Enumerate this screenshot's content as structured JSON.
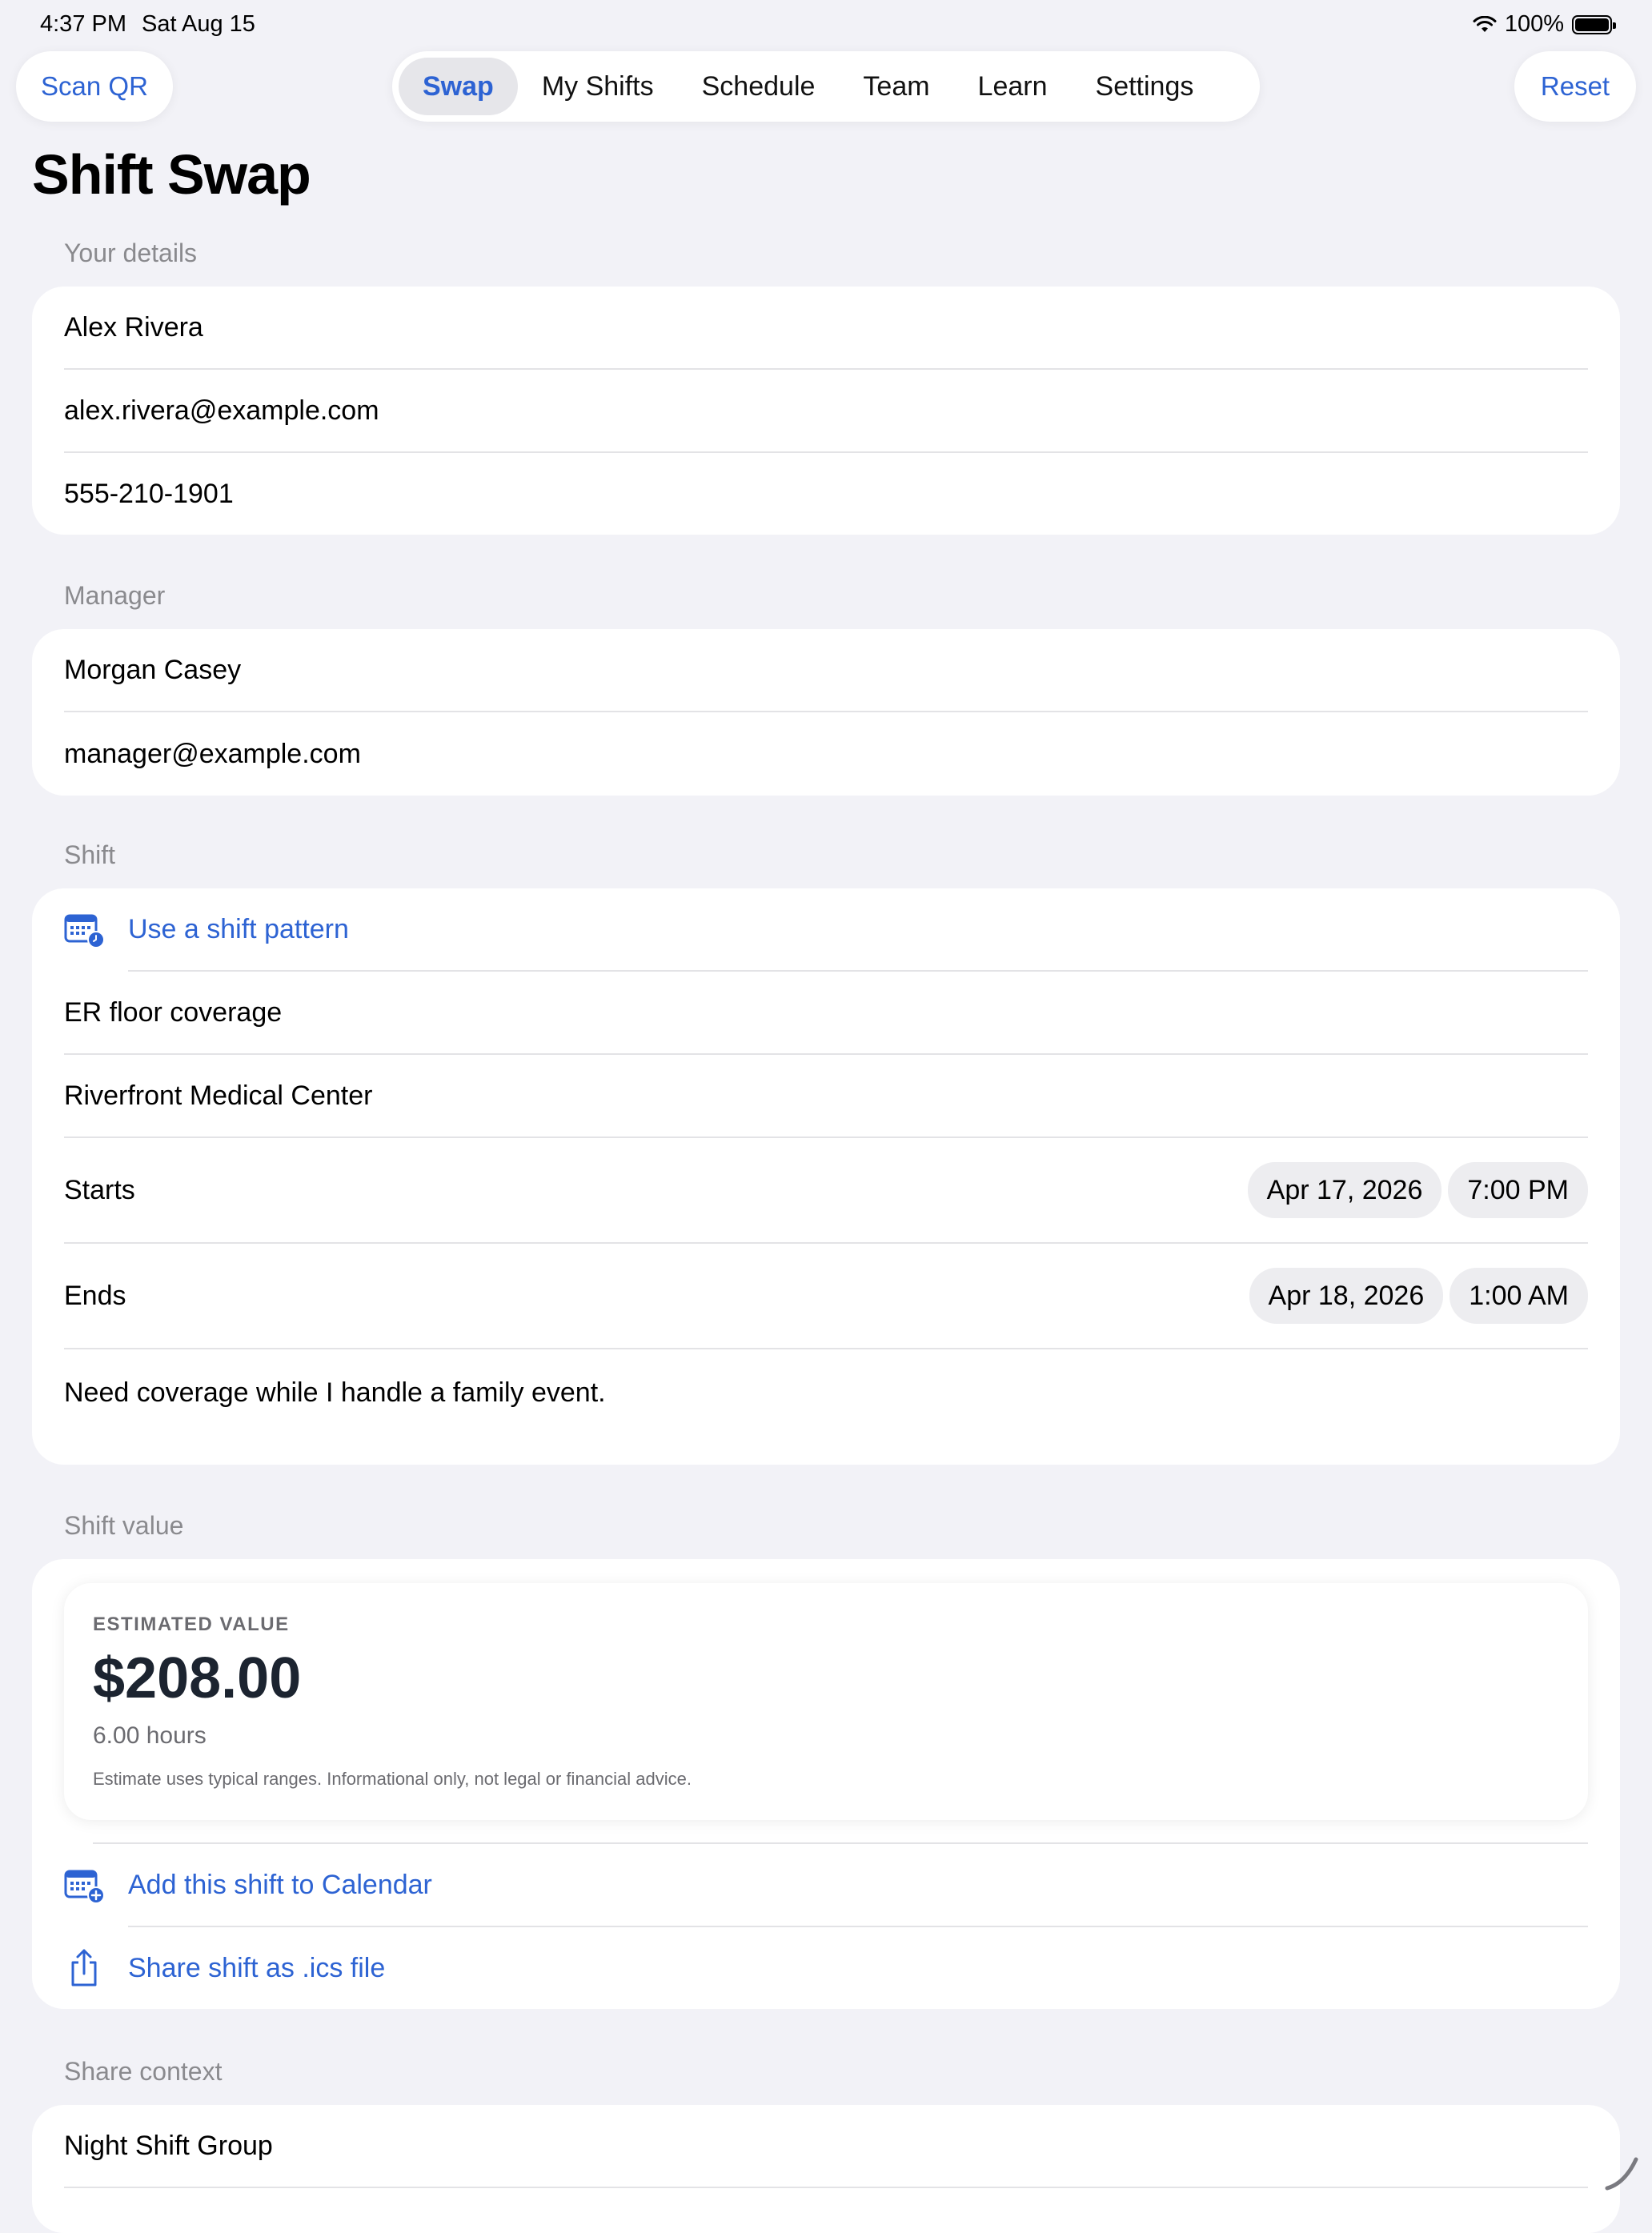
{
  "status": {
    "time": "4:37 PM",
    "date": "Sat Aug 15",
    "battery": "100%"
  },
  "toolbar": {
    "scan_label": "Scan QR",
    "reset_label": "Reset"
  },
  "tabs": [
    {
      "label": "Swap",
      "active": true
    },
    {
      "label": "My Shifts",
      "active": false
    },
    {
      "label": "Schedule",
      "active": false
    },
    {
      "label": "Team",
      "active": false
    },
    {
      "label": "Learn",
      "active": false
    },
    {
      "label": "Settings",
      "active": false
    }
  ],
  "page_title": "Shift Swap",
  "your_details": {
    "header": "Your details",
    "name": "Alex Rivera",
    "email": "alex.rivera@example.com",
    "phone": "555-210-1901"
  },
  "manager": {
    "header": "Manager",
    "name": "Morgan Casey",
    "email": "manager@example.com"
  },
  "shift": {
    "header": "Shift",
    "pattern_link": "Use a shift pattern",
    "title": "ER floor coverage",
    "location": "Riverfront Medical Center",
    "starts_label": "Starts",
    "starts_date": "Apr 17, 2026",
    "starts_time": "7:00 PM",
    "ends_label": "Ends",
    "ends_date": "Apr 18, 2026",
    "ends_time": "1:00 AM",
    "note": "Need coverage while I handle a family event."
  },
  "shift_value": {
    "header": "Shift value",
    "estimated_label": "ESTIMATED VALUE",
    "amount": "$208.00",
    "hours": "6.00 hours",
    "disclaimer": "Estimate uses typical ranges. Informational only, not legal or financial advice.",
    "calendar_link": "Add this shift to Calendar",
    "share_link": "Share shift as .ics file"
  },
  "share_context": {
    "header": "Share context",
    "group": "Night Shift Group"
  },
  "colors": {
    "accent": "#2d63d3",
    "background": "#f2f2f7",
    "card": "#ffffff",
    "secondary_text": "#8a8a8e"
  }
}
